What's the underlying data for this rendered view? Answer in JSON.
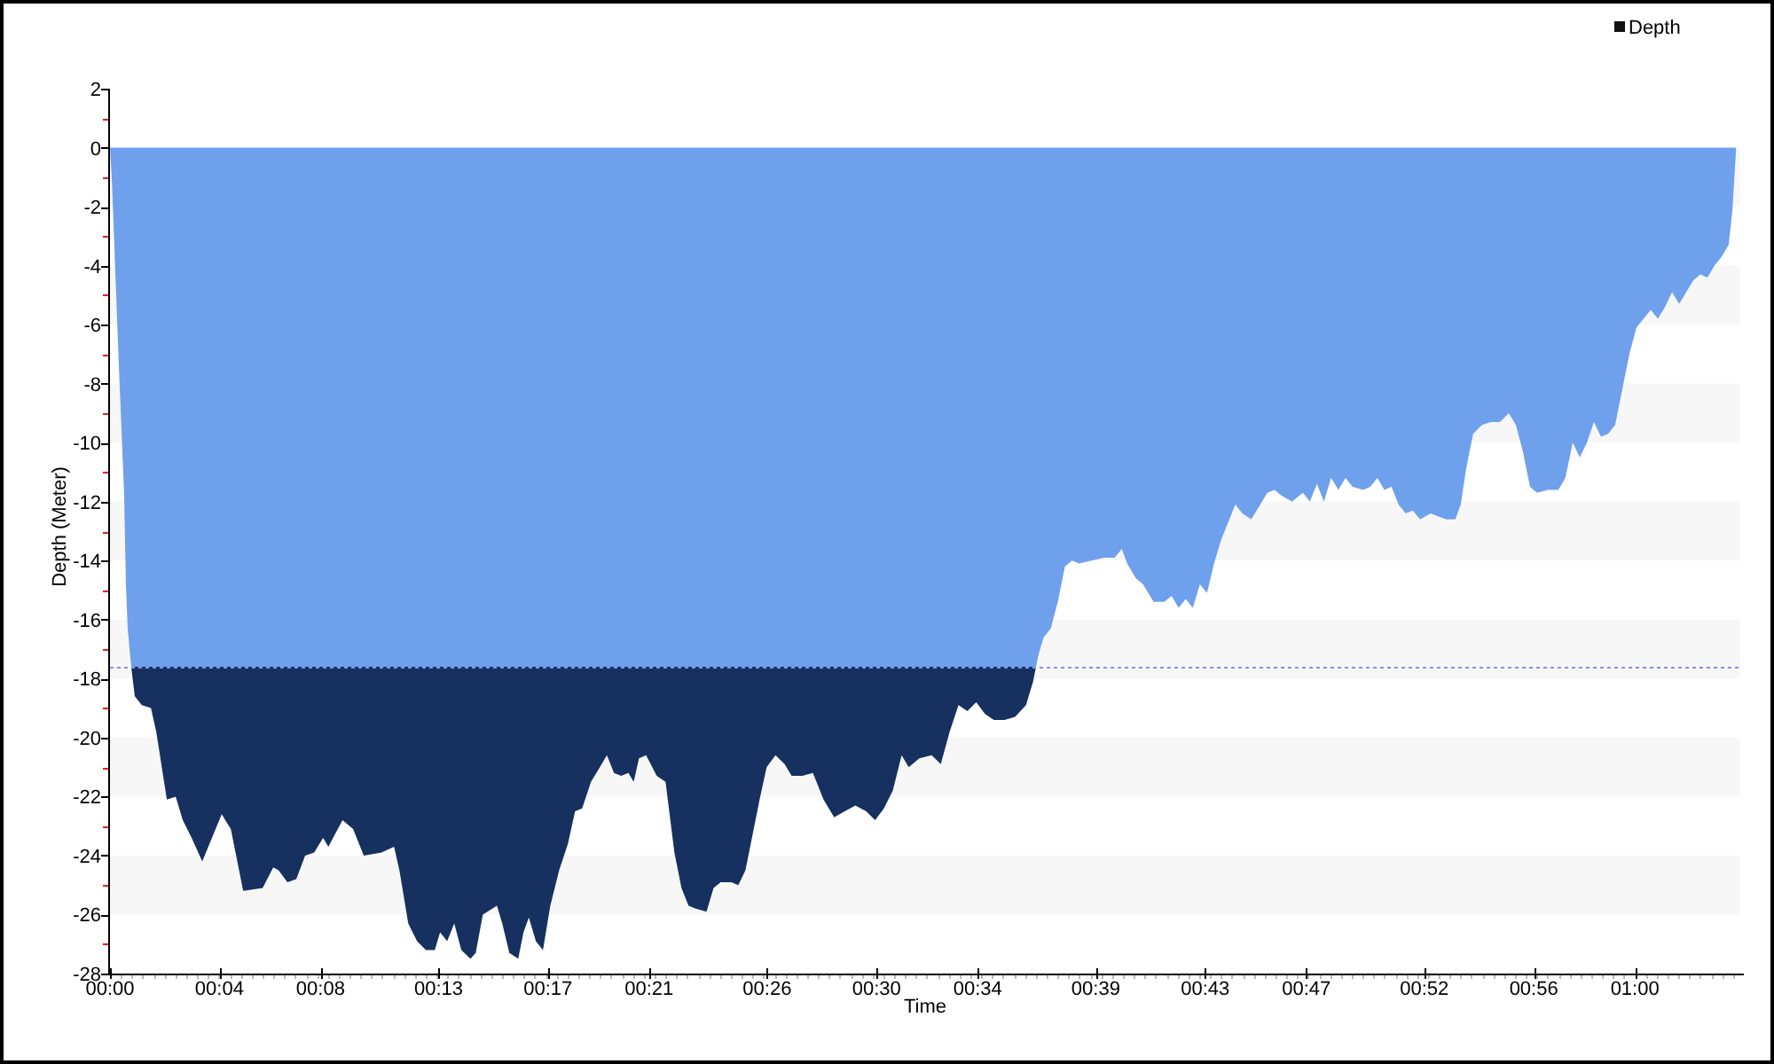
{
  "chart": {
    "chart_data": {
      "type": "area",
      "xlabel": "Time",
      "ylabel": "Depth (Meter)",
      "x": [
        0,
        0.07,
        0.14,
        0.21,
        0.28,
        0.35,
        0.42,
        0.49,
        0.56,
        0.63,
        0.7,
        0.84,
        0.98,
        1.26,
        1.62,
        1.83,
        2.25,
        2.6,
        2.88,
        3.23,
        3.65,
        4.42,
        4.78,
        5.27,
        6.04,
        6.46,
        6.67,
        7.02,
        7.37,
        7.72,
        8.08,
        8.43,
        8.64,
        9.2,
        9.62,
        10.04,
        10.74,
        11.24,
        11.45,
        11.8,
        12.15,
        12.5,
        12.85,
        13.06,
        13.34,
        13.62,
        13.9,
        14.26,
        14.47,
        14.75,
        15.31,
        15.52,
        15.8,
        16.15,
        16.36,
        16.57,
        16.85,
        17.13,
        17.42,
        17.77,
        18.12,
        18.4,
        18.68,
        19.03,
        19.38,
        19.66,
        19.94,
        20.22,
        20.51,
        20.72,
        20.93,
        21.21,
        21.63,
        21.98,
        22.33,
        22.61,
        22.89,
        23.17,
        23.6,
        23.88,
        24.16,
        24.58,
        24.86,
        25.14,
        25.42,
        25.7,
        25.98,
        26.33,
        26.69,
        26.97,
        27.39,
        27.81,
        28.23,
        28.65,
        29.07,
        29.49,
        29.92,
        30.27,
        30.62,
        30.97,
        31.32,
        31.6,
        32.02,
        32.51,
        32.87,
        33.22,
        33.57,
        33.92,
        34.27,
        34.62,
        34.97,
        35.39,
        35.81,
        36.24,
        36.52,
        36.73,
        36.94,
        37.22,
        37.5,
        37.78,
        38.06,
        38.34,
        39.33,
        39.75,
        40.03,
        40.24,
        40.59,
        40.87,
        41.29,
        41.71,
        42.0,
        42.28,
        42.56,
        42.84,
        43.12,
        43.4,
        43.68,
        43.96,
        44.24,
        44.52,
        44.8,
        45.15,
        45.51,
        45.79,
        46.07,
        46.35,
        46.77,
        47.19,
        47.47,
        47.75,
        48.03,
        48.31,
        48.6,
        48.88,
        49.16,
        49.58,
        49.86,
        50.14,
        50.42,
        50.7,
        50.98,
        51.26,
        51.54,
        51.83,
        52.25,
        52.53,
        52.88,
        53.23,
        53.44,
        53.65,
        53.93,
        54.28,
        54.63,
        54.99,
        55.34,
        55.62,
        55.9,
        56.18,
        56.46,
        56.88,
        57.3,
        57.58,
        57.87,
        58.15,
        58.43,
        58.71,
        58.99,
        59.27,
        59.55,
        59.83,
        60.11,
        60.39,
        60.67,
        60.96,
        61.24,
        61.52,
        61.8,
        62.08,
        62.36,
        62.64,
        62.92,
        63.2,
        63.48,
        63.76,
        64.04,
        64.19,
        64.33
      ],
      "series": [
        {
          "name": "Depth",
          "color": "#6fa0ec",
          "values": [
            0,
            -1.0,
            -2.6,
            -4.2,
            -5.8,
            -7.4,
            -8.8,
            -10.3,
            -11.8,
            -14.8,
            -16.3,
            -17.6,
            -18.6,
            -18.9,
            -19.0,
            -19.8,
            -22.1,
            -22.0,
            -22.8,
            -23.4,
            -24.2,
            -22.6,
            -23.1,
            -25.2,
            -25.1,
            -24.4,
            -24.5,
            -24.9,
            -24.8,
            -24.0,
            -23.9,
            -23.4,
            -23.7,
            -22.8,
            -23.1,
            -24.0,
            -23.9,
            -23.7,
            -24.5,
            -26.3,
            -26.9,
            -27.2,
            -27.2,
            -26.6,
            -26.9,
            -26.3,
            -27.2,
            -27.5,
            -27.3,
            -26.0,
            -25.7,
            -26.3,
            -27.3,
            -27.5,
            -26.6,
            -26.1,
            -26.9,
            -27.2,
            -25.7,
            -24.5,
            -23.6,
            -22.5,
            -22.4,
            -21.5,
            -21.0,
            -20.6,
            -21.2,
            -21.3,
            -21.2,
            -21.5,
            -20.7,
            -20.6,
            -21.3,
            -21.5,
            -23.9,
            -25.1,
            -25.7,
            -25.8,
            -25.9,
            -25.1,
            -24.9,
            -24.9,
            -25.0,
            -24.5,
            -23.3,
            -22.1,
            -21.0,
            -20.6,
            -20.9,
            -21.3,
            -21.3,
            -21.2,
            -22.1,
            -22.7,
            -22.5,
            -22.3,
            -22.5,
            -22.8,
            -22.4,
            -21.8,
            -20.6,
            -21.0,
            -20.7,
            -20.6,
            -20.9,
            -19.8,
            -18.9,
            -19.1,
            -18.8,
            -19.2,
            -19.4,
            -19.4,
            -19.3,
            -18.9,
            -18.1,
            -17.2,
            -16.6,
            -16.3,
            -15.4,
            -14.2,
            -14.0,
            -14.1,
            -13.9,
            -13.9,
            -13.6,
            -14.1,
            -14.6,
            -14.8,
            -15.4,
            -15.4,
            -15.2,
            -15.6,
            -15.3,
            -15.6,
            -14.8,
            -15.1,
            -14.1,
            -13.3,
            -12.7,
            -12.1,
            -12.4,
            -12.6,
            -12.1,
            -11.7,
            -11.6,
            -11.8,
            -12.0,
            -11.7,
            -12.0,
            -11.4,
            -12.0,
            -11.2,
            -11.6,
            -11.2,
            -11.5,
            -11.6,
            -11.5,
            -11.2,
            -11.6,
            -11.5,
            -12.1,
            -12.4,
            -12.3,
            -12.6,
            -12.4,
            -12.5,
            -12.6,
            -12.6,
            -12.1,
            -10.9,
            -9.7,
            -9.4,
            -9.3,
            -9.3,
            -9.0,
            -9.4,
            -10.3,
            -11.5,
            -11.7,
            -11.6,
            -11.6,
            -11.2,
            -10.0,
            -10.5,
            -10.0,
            -9.3,
            -9.8,
            -9.7,
            -9.4,
            -8.2,
            -7.0,
            -6.1,
            -5.8,
            -5.5,
            -5.8,
            -5.4,
            -4.9,
            -5.3,
            -4.9,
            -4.5,
            -4.3,
            -4.4,
            -4.0,
            -3.7,
            -3.3,
            -2.1,
            -0.1
          ]
        }
      ],
      "xlim": [
        0,
        64.5
      ],
      "ylim": [
        -28,
        2
      ],
      "xticks": [
        {
          "value": 0,
          "label": "00:00"
        },
        {
          "value": 4.33,
          "label": "00:04"
        },
        {
          "value": 8.33,
          "label": "00:08"
        },
        {
          "value": 13,
          "label": "00:13"
        },
        {
          "value": 17.33,
          "label": "00:17"
        },
        {
          "value": 21.33,
          "label": "00:21"
        },
        {
          "value": 26,
          "label": "00:26"
        },
        {
          "value": 30.33,
          "label": "00:30"
        },
        {
          "value": 34.33,
          "label": "00:34"
        },
        {
          "value": 39,
          "label": "00:39"
        },
        {
          "value": 43.33,
          "label": "00:43"
        },
        {
          "value": 47.33,
          "label": "00:47"
        },
        {
          "value": 52,
          "label": "00:52"
        },
        {
          "value": 56.33,
          "label": "00:56"
        },
        {
          "value": 60.33,
          "label": "01:00"
        }
      ],
      "yticks": [
        2,
        0,
        -2,
        -4,
        -6,
        -8,
        -10,
        -12,
        -14,
        -16,
        -18,
        -20,
        -22,
        -24,
        -26,
        -28
      ],
      "ref_lines": [
        {
          "axis": "y",
          "value": -17.6
        }
      ]
    }
  }
}
